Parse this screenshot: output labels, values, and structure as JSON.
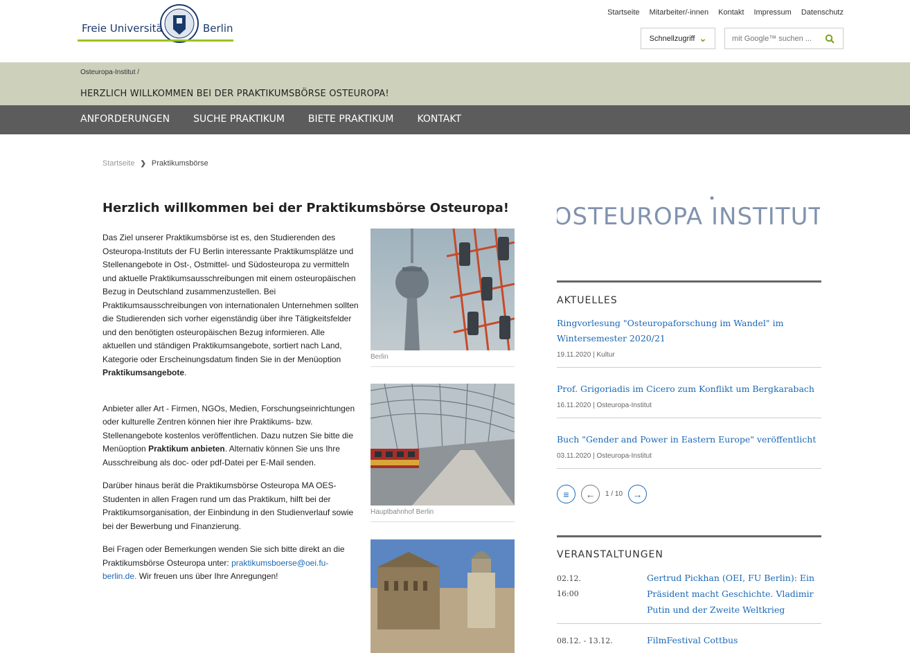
{
  "header": {
    "logo_left": "Freie Universität",
    "logo_right": "Berlin",
    "top_links": [
      "Startseite",
      "Mitarbeiter/-innen",
      "Kontakt",
      "Impressum",
      "Datenschutz"
    ],
    "quick_access": "Schnellzugriff",
    "search_placeholder": "mit Google™ suchen ..."
  },
  "titlebar": {
    "crumb": "Osteuropa-Institut  /",
    "title": "HERZLICH WILLKOMMEN BEI DER PRAKTIKUMSBÖRSE OSTEUROPA!"
  },
  "nav": [
    "ANFORDERUNGEN",
    "SUCHE PRAKTIKUM",
    "BIETE PRAKTIKUM",
    "KONTAKT"
  ],
  "breadcrumb": {
    "home": "Startseite",
    "current": "Praktikumsbörse"
  },
  "main": {
    "title": "Herzlich willkommen bei der Praktikumsbörse Osteuropa!",
    "p1": "Das Ziel unserer Praktikumsbörse ist es, den Studierenden des Osteuropa-Instituts der FU Berlin interessante Praktikumsplätze und Stellenangebote in Ost-, Ostmittel- und Südosteuropa zu vermitteln und aktuelle Praktikumsausschreibungen mit einem osteuropäischen Bezug in Deutschland zusammenzustellen. Bei Praktikumsausschreibungen von internationalen Unternehmen sollten die Studierenden sich vorher eigenständig über ihre Tätigkeitsfelder und den benötigten osteuropäischen Bezug informieren. Alle aktuellen und ständigen Praktikumsangebote, sortiert nach Land, Kategorie oder Erscheinungsdatum finden Sie in der Menüoption",
    "p1_bold": "Praktikumsangebote",
    "p1_end": ".",
    "p2": "Anbieter aller Art - Firmen, NGOs, Medien, Forschungseinrichtungen oder kulturelle Zentren können hier ihre Praktikums- bzw. Stellenangebote kostenlos veröffentlichen. Dazu nutzen Sie bitte die Menüoption",
    "p2_bold": "Praktikum anbieten",
    "p2_end": ". Alternativ können Sie uns Ihre Ausschreibung als doc- oder pdf-Datei per E-Mail senden.",
    "p3": "Darüber hinaus berät die Praktikumsbörse Osteuropa MA OES-Studenten in allen Fragen rund um das Praktikum, hilft bei der Praktikumsorganisation, der Einbindung in den Studienverlauf sowie bei der Bewerbung und Finanzierung.",
    "p4": "Bei Fragen oder Bemerkungen wenden Sie sich bitte direkt an die Praktikumsbörse Osteuropa unter:",
    "p4_link": "praktikumsboerse@oei.fu-berlin.de.",
    "p4_end": " Wir freuen uns über Ihre Anregungen!",
    "captions": [
      "Berlin",
      "Hauptbahnhof Berlin"
    ]
  },
  "sidebar": {
    "logo_text": "OSTEUROPA INSTITUT",
    "news_heading": "AKTUELLES",
    "news": [
      {
        "title": "Ringvorlesung \"Osteuropaforschung im Wandel\" im Wintersemester 2020/21",
        "meta": "19.11.2020 | Kultur"
      },
      {
        "title": "Prof. Grigoriadis im Cicero zum Konflikt um Bergkarabach",
        "meta": "16.11.2020 | Osteuropa-Institut"
      },
      {
        "title": "Buch \"Gender and Power in Eastern Europe\" veröffentlicht",
        "meta": "03.11.2020 | Osteuropa-Institut"
      }
    ],
    "pager": "1 / 10",
    "events_heading": "VERANSTALTUNGEN",
    "events": [
      {
        "date": "02.12.",
        "time": "16:00",
        "title": "Gertrud Pickhan (OEI, FU Berlin): Ein Präsident macht Geschichte. Vladimir Putin und der Zweite Weltkrieg"
      },
      {
        "date": "08.12. - 13.12.",
        "time": "",
        "title": "FilmFestival Cottbus"
      }
    ]
  },
  "colors": {
    "accent_green": "#99c221",
    "link_blue": "#1a68b5",
    "titlebar": "#cdd0bb",
    "nav": "#5c5c5c"
  }
}
